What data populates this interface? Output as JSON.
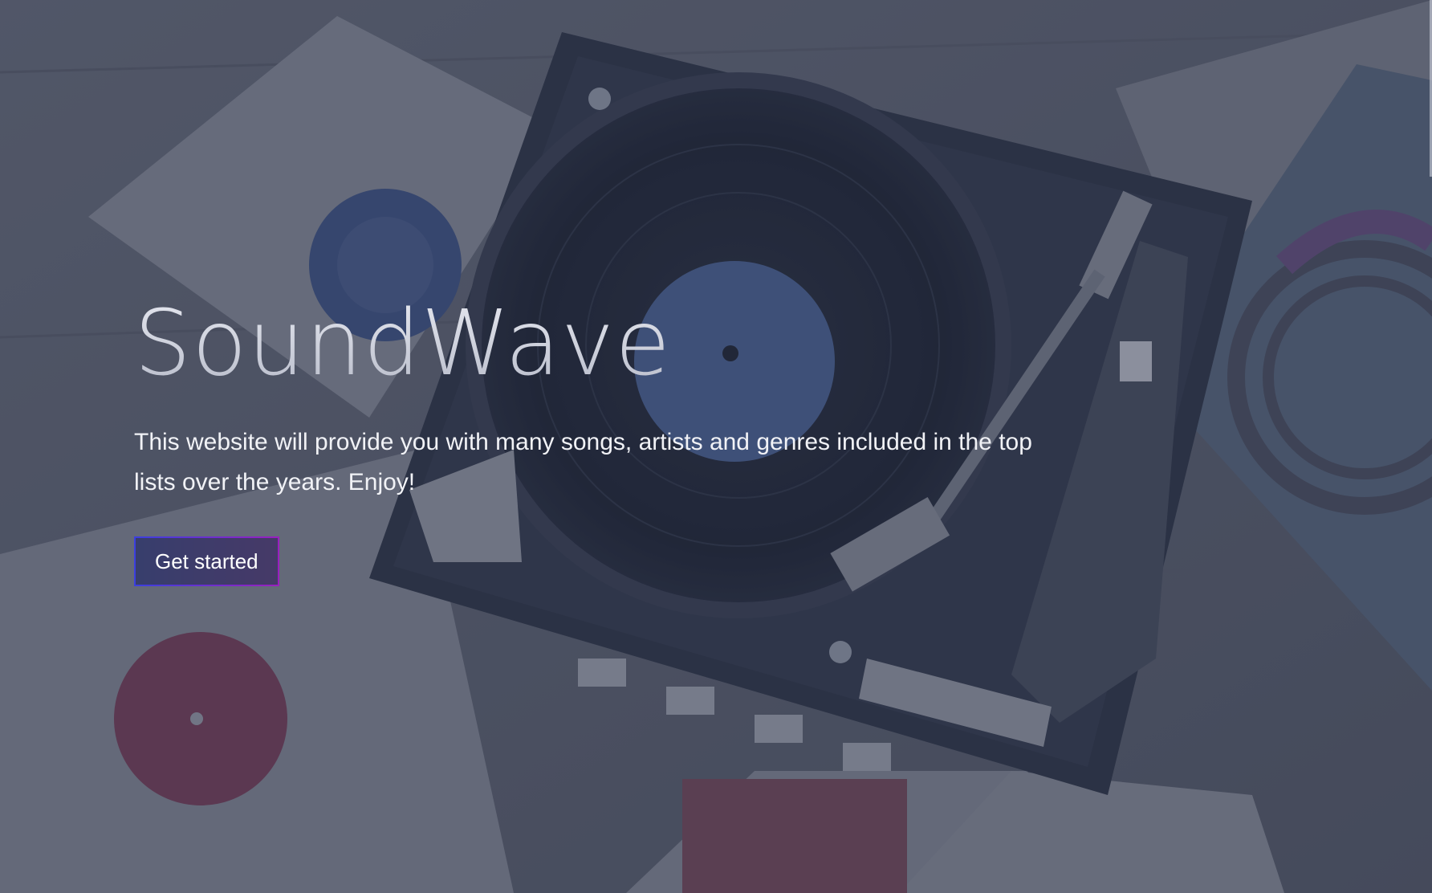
{
  "hero": {
    "title": "SoundWave",
    "tagline": "This website will provide you with many songs, artists and genres included in the top lists over the years. Enjoy!",
    "cta_label": "Get started"
  },
  "colors": {
    "overlay": "#283048",
    "title": "#d2d4de",
    "text": "#f1f2f6",
    "cta_gradient_start": "#3b3fe0",
    "cta_gradient_end": "#9a1fbf"
  }
}
